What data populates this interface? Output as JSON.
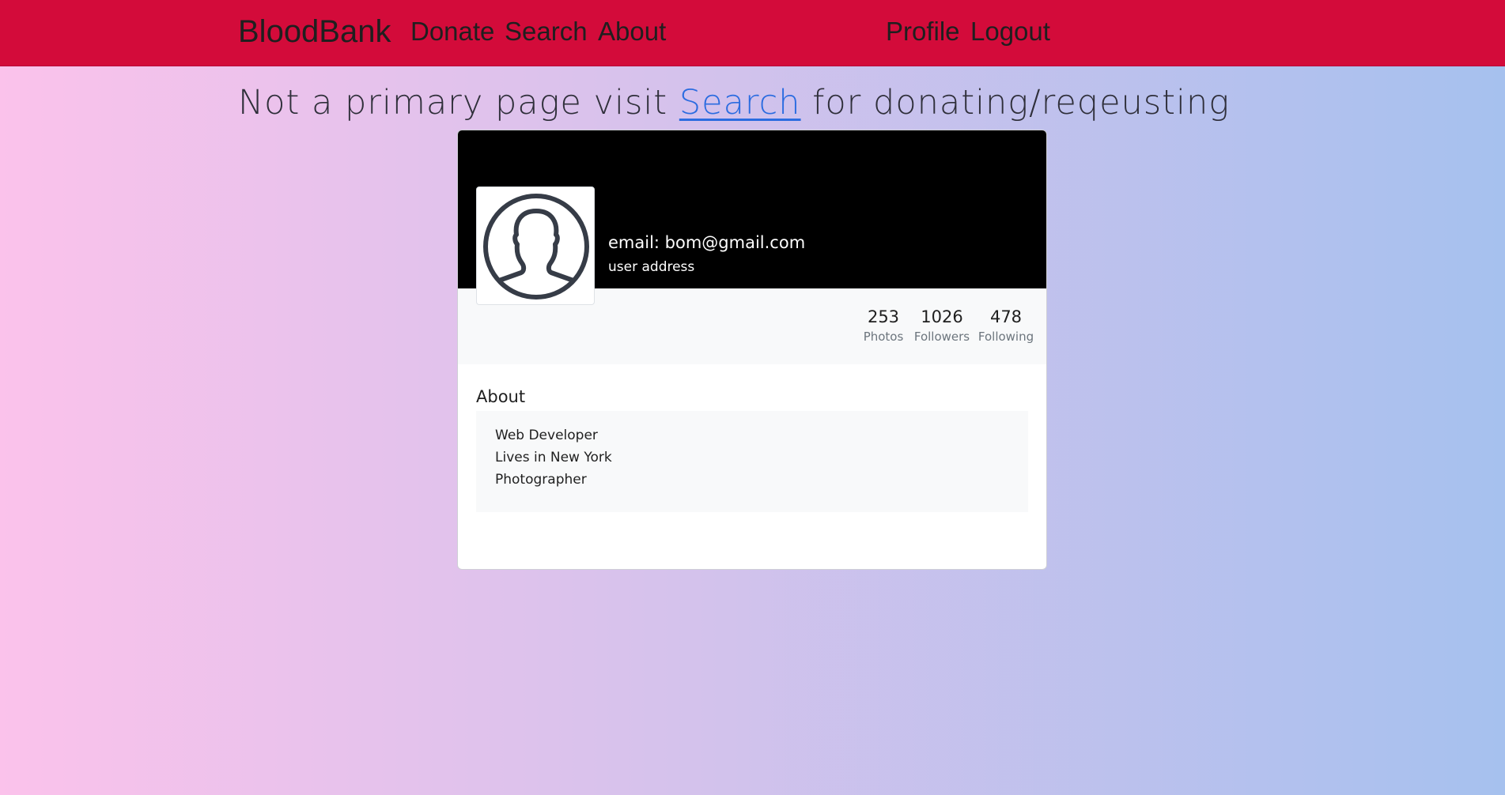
{
  "nav": {
    "brand": "BloodBank",
    "links": [
      "Donate",
      "Search",
      "About"
    ],
    "right_links": [
      "Profile",
      "Logout"
    ]
  },
  "notice": {
    "before": "Not a primary page visit",
    "link": "Search",
    "after": "for donating/reqeusting"
  },
  "profile": {
    "email": "email: bom@gmail.com",
    "address": "user address",
    "avatar_icon": "user-silhouette-icon",
    "stats": [
      {
        "value": "253",
        "label": "Photos"
      },
      {
        "value": "1026",
        "label": "Followers"
      },
      {
        "value": "478",
        "label": "Following"
      }
    ],
    "about_title": "About",
    "about_lines": [
      "Web Developer",
      "Lives in New York",
      "Photographer"
    ]
  },
  "colors": {
    "navbar": "#d30b3a",
    "link": "#2b6ce0",
    "header_bg": "#000000"
  }
}
